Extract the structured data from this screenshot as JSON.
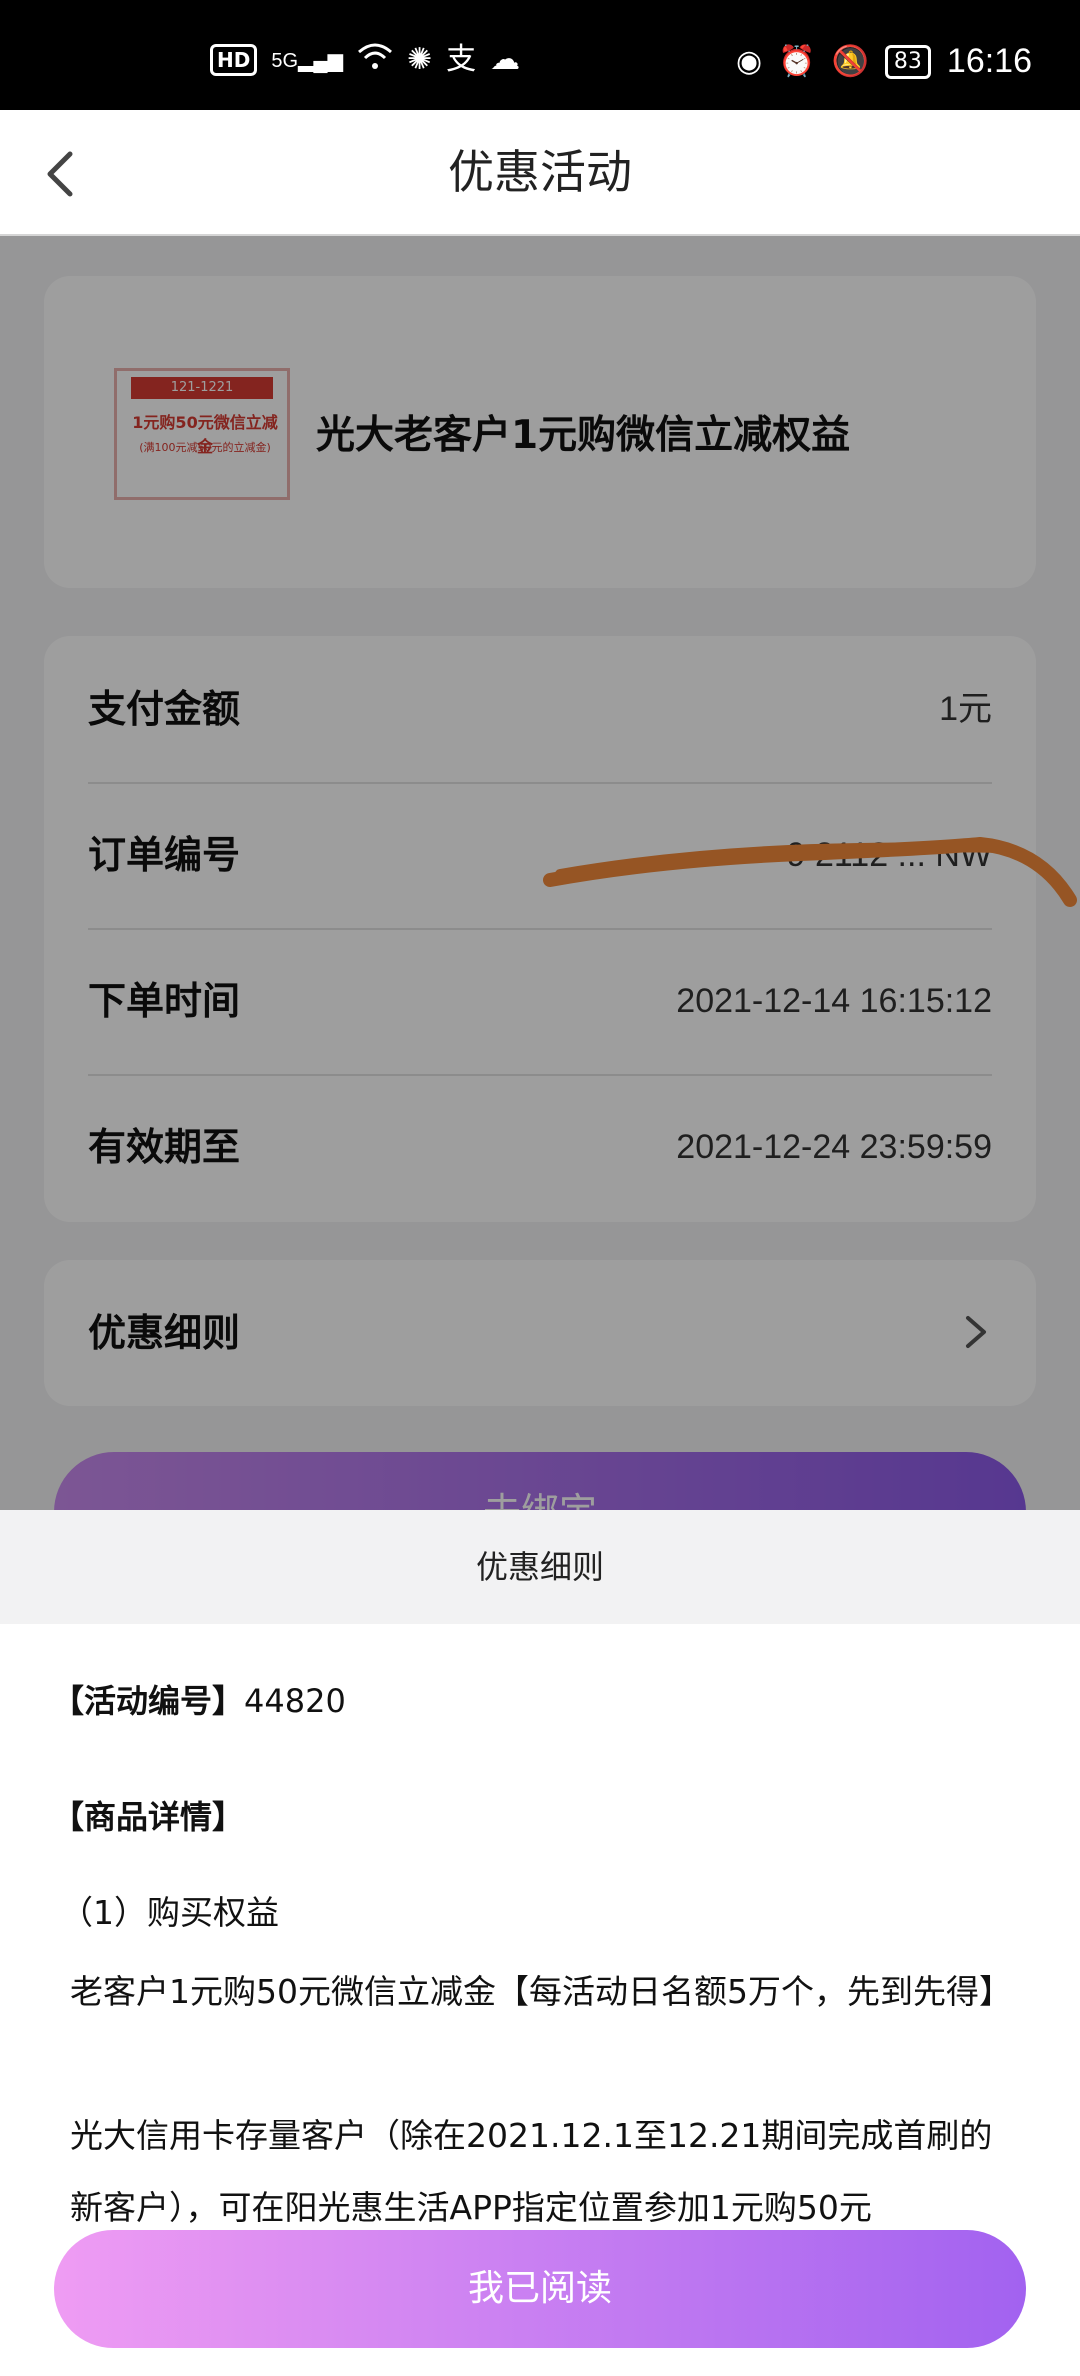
{
  "status_bar": {
    "left_hd": "HD",
    "left_signal": "5G",
    "right_battery": "83",
    "time": "16:16",
    "icons": [
      "hd-icon",
      "signal-icon",
      "wifi-icon",
      "sun-icon",
      "alipay-icon",
      "cloud-icon",
      "nfc-icon",
      "alarm-icon",
      "mute-icon",
      "battery-icon"
    ]
  },
  "header": {
    "title": "优惠活动",
    "back_icon": "chevron-left-icon"
  },
  "product": {
    "title": "光大老客户1元购微信立减权益",
    "thumb_top": "121-1221",
    "thumb_main": "1元购50元微信立减金",
    "thumb_sub": "(满100元减50元的立减金)"
  },
  "order_info": {
    "rows": [
      {
        "label": "支付金额",
        "value": "1元"
      },
      {
        "label": "订单编号",
        "value": "9 2112 ... NW"
      },
      {
        "label": "下单时间",
        "value": "2021-12-14 16:15:12"
      },
      {
        "label": "有效期至",
        "value": "2021-12-24 23:59:59"
      }
    ]
  },
  "rules_link": {
    "label": "优惠细则",
    "icon": "chevron-right-icon"
  },
  "bind_button": "去绑定",
  "sheet": {
    "title": "优惠细则",
    "activity_no_label": "【活动编号】",
    "activity_no_value": "44820",
    "details_label": "【商品详情】",
    "sub_title": "（1）购买权益",
    "para1": "老客户1元购50元微信立减金【每活动日名额5万个，先到先得】",
    "para2": "光大信用卡存量客户（除在2021.12.1至12.21期间完成首刷的新客户），可在阳光惠生活APP指定位置参加1元购50元"
  },
  "read_button": "我已阅读",
  "colors": {
    "accent_start": "#ef9cf3",
    "accent_end": "#a262f0",
    "scribble": "#f28a3a"
  }
}
